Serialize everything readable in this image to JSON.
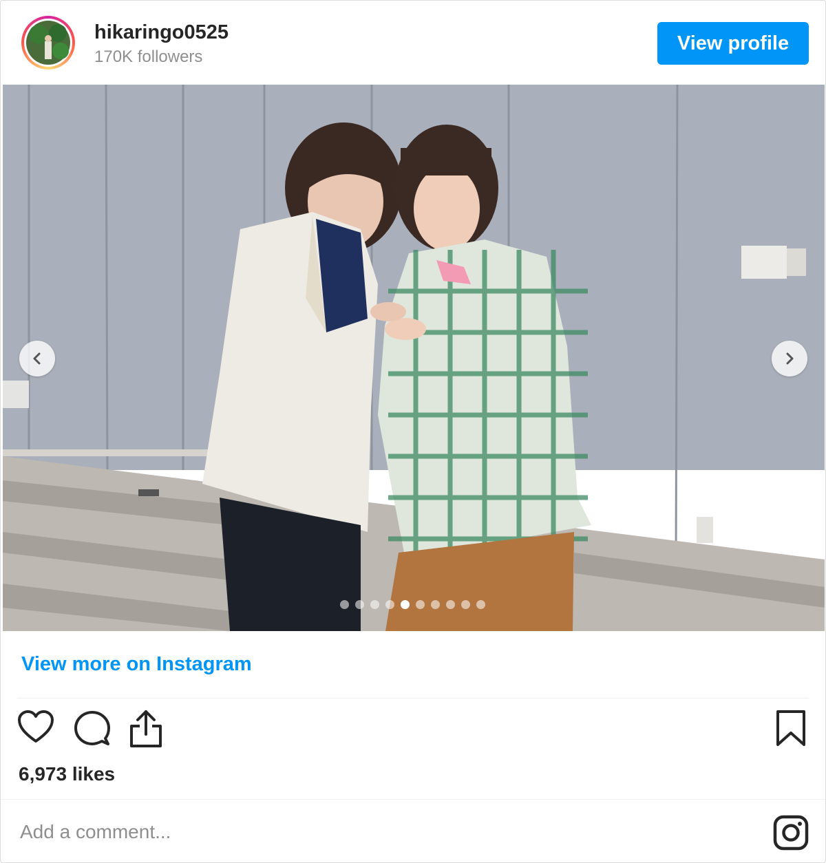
{
  "header": {
    "username": "hikaringo0525",
    "followers": "170K followers",
    "view_profile_label": "View profile",
    "avatar_icon": "profile-avatar"
  },
  "post": {
    "carousel": {
      "slide_count": 10,
      "active_index": 4
    },
    "view_more_label": "View more on Instagram",
    "likes": "6,973 likes",
    "comment_placeholder": "Add a comment..."
  },
  "icons": {
    "like": "heart-icon",
    "comment": "comment-icon",
    "share": "share-icon",
    "save": "bookmark-icon",
    "instagram": "instagram-icon",
    "prev": "chevron-left-icon",
    "next": "chevron-right-icon"
  },
  "colors": {
    "accent": "#0095f6",
    "text": "#262626",
    "muted": "#8e8e8e"
  }
}
